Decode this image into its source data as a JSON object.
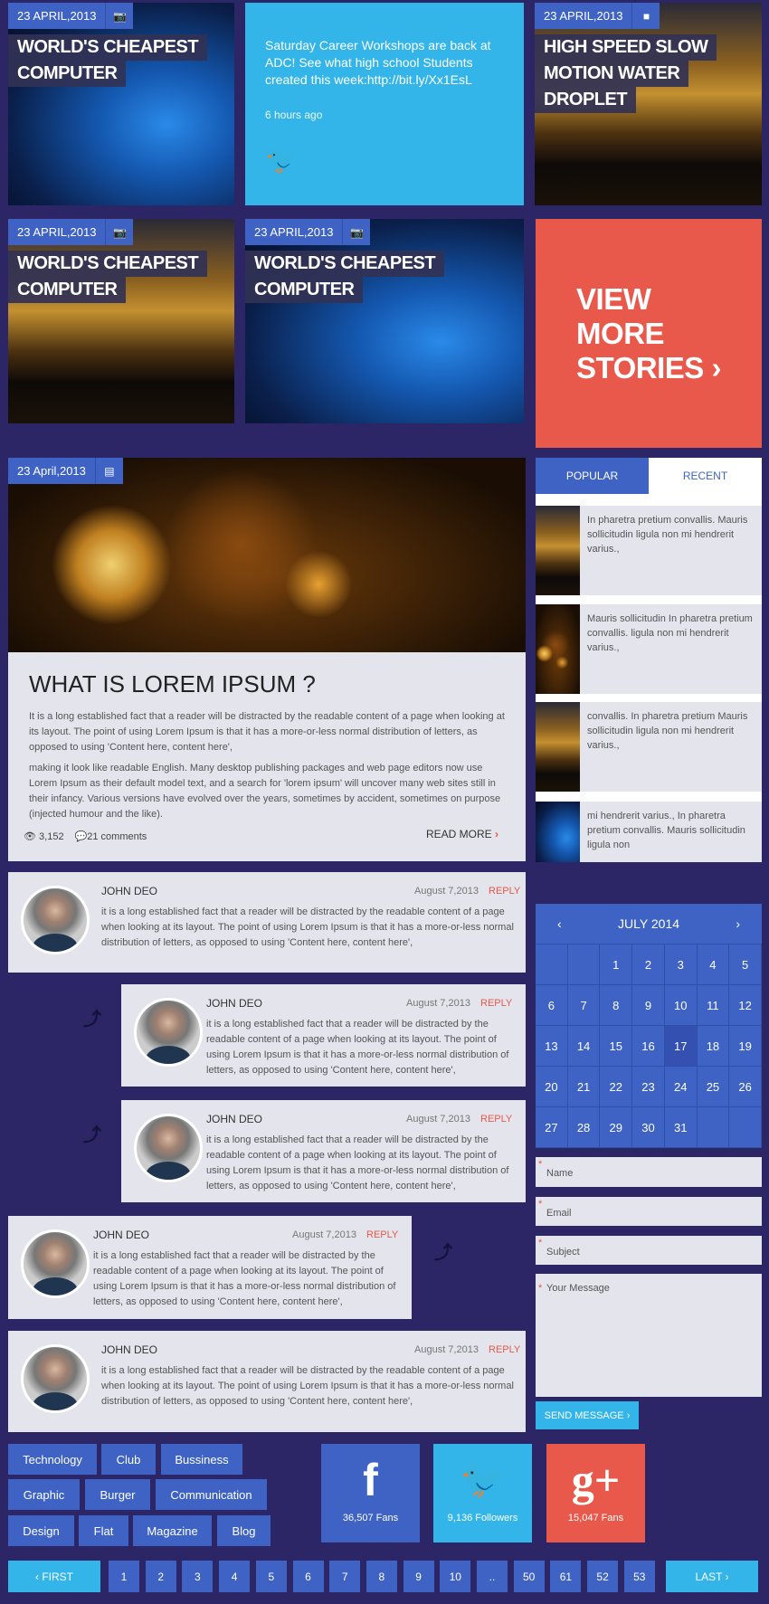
{
  "colors": {
    "background": "#2c2566",
    "blue": "#3e63c4",
    "twitter": "#33b5e9",
    "red": "#e8594b",
    "card": "#e3e4ec"
  },
  "tiles": [
    {
      "date": "23 APRIL,2013",
      "icon": "camera-icon",
      "title_lines": [
        "WORLD'S CHEAPEST",
        "COMPUTER"
      ]
    },
    {
      "date": "23 APRIL,2013",
      "icon": "video-icon",
      "title_lines": [
        "HIGH SPEED SLOW",
        "MOTION WATER",
        "DROPLET"
      ]
    },
    {
      "date": "23 APRIL,2013",
      "icon": "camera-icon",
      "title_lines": [
        "WORLD'S CHEAPEST",
        "COMPUTER"
      ]
    },
    {
      "date": "23 APRIL,2013",
      "icon": "camera-icon",
      "title_lines": [
        "WORLD'S CHEAPEST",
        "COMPUTER"
      ]
    }
  ],
  "tweet": {
    "text": "Saturday Career Workshops are back at ADC! See what high school Students created this week:http://bit.ly/Xx1EsL",
    "time": "6 hours ago",
    "icon": "twitter-icon"
  },
  "view_more": {
    "lines": [
      "VIEW",
      "MORE",
      "STORIES ›"
    ]
  },
  "post": {
    "date": "23 April,2013",
    "icon": "document-icon",
    "title": "WHAT IS LOREM IPSUM ?",
    "paragraphs": [
      "It is a long established fact that a reader will be distracted by the readable content of a page when looking at its layout. The point of using Lorem Ipsum is that it has a more-or-less normal distribution of letters, as opposed to using 'Content here, content here',",
      "making it look like readable English. Many desktop publishing packages and web page editors now use Lorem Ipsum as their default model text, and a search for 'lorem ipsum' will uncover many web sites still in their infancy. Various versions have evolved over the years, sometimes by accident, sometimes on purpose (injected humour and the like)."
    ],
    "views": "3,152",
    "comments": "21 comments",
    "read_more": "READ MORE"
  },
  "sidebar": {
    "tabs": [
      "POPULAR",
      "RECENT"
    ],
    "items": [
      "In pharetra pretium convallis. Mauris sollicitudin ligula non mi hendrerit varius.,",
      "Mauris sollicitudin In pharetra pretium convallis. ligula non mi hendrerit varius.,",
      "convallis. In pharetra pretium Mauris sollicitudin ligula non mi hendrerit varius.,",
      "mi hendrerit varius., In pharetra pretium convallis. Mauris sollicitudin ligula non"
    ]
  },
  "calendar": {
    "month": "JULY 2014",
    "days": [
      "",
      "",
      "1",
      "2",
      "3",
      "4",
      "5",
      "6",
      "7",
      "8",
      "9",
      "10",
      "11",
      "12",
      "13",
      "14",
      "15",
      "16",
      "17",
      "18",
      "19",
      "20",
      "21",
      "22",
      "23",
      "24",
      "25",
      "26",
      "27",
      "28",
      "29",
      "30",
      "31",
      "",
      ""
    ],
    "selected": "17"
  },
  "form": {
    "name": "Name",
    "email": "Email",
    "subject": "Subject",
    "message": "Your Message",
    "required": "*",
    "send": "SEND MESSAGE ›"
  },
  "comments": {
    "author": "JOHN DEO",
    "date": "August 7,2013",
    "reply": "REPLY",
    "text": "it is a long established fact that a reader will be distracted by the readable content of a page when looking at its layout. The point of using Lorem Ipsum is that it has a more-or-less normal distribution of letters, as opposed to using 'Content here, content here',"
  },
  "tags": [
    "Technology",
    "Club",
    "Bussiness",
    "Graphic",
    "Burger",
    "Communication",
    "Design",
    "Flat",
    "Magazine",
    "Blog"
  ],
  "social": [
    {
      "icon": "facebook-icon",
      "glyph": "f",
      "count": "36,507 Fans"
    },
    {
      "icon": "twitter-icon",
      "glyph": "🐦",
      "count": "9,136 Followers"
    },
    {
      "icon": "google-plus-icon",
      "glyph": "g+",
      "count": "15,047 Fans"
    }
  ],
  "pagination": {
    "first": "‹ FIRST",
    "last": "LAST ›",
    "pages": [
      "1",
      "2",
      "3",
      "4",
      "5",
      "6",
      "7",
      "8",
      "9",
      "10",
      "..",
      "50",
      "61",
      "52",
      "53"
    ]
  }
}
